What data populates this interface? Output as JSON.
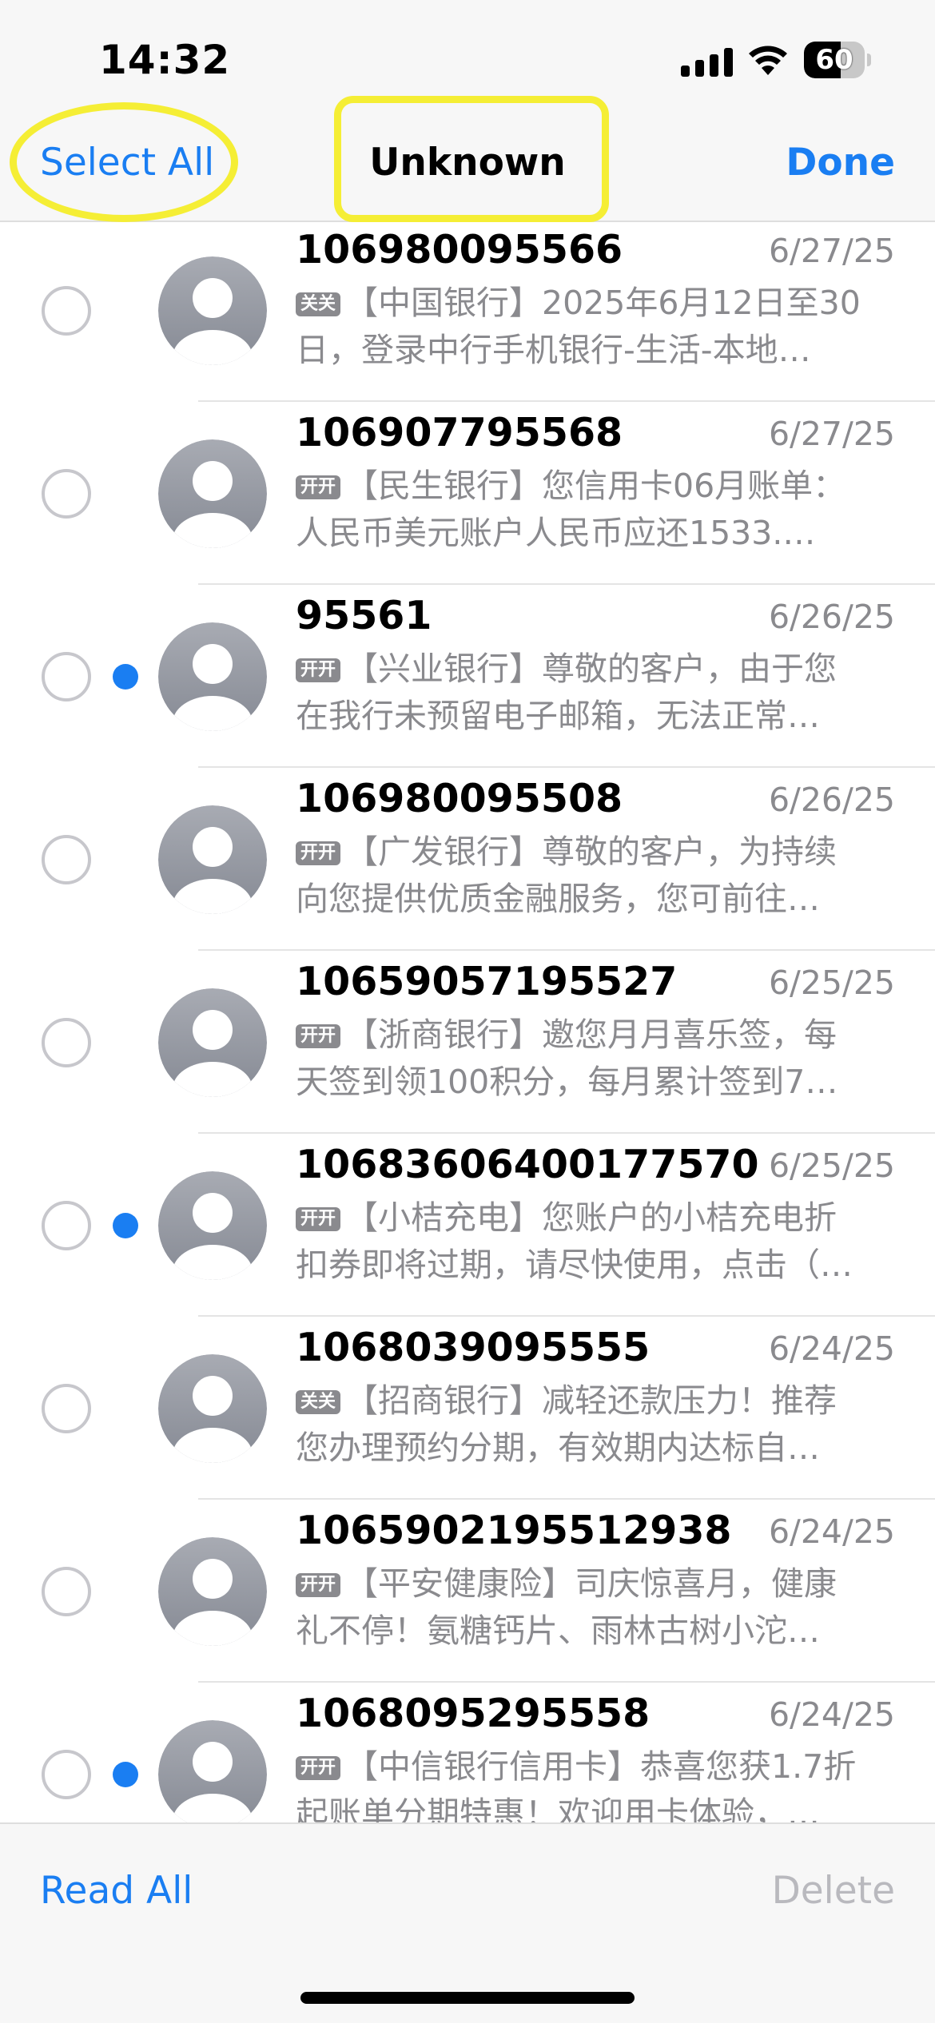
{
  "status_bar": {
    "time": "14:32",
    "battery_level": "60",
    "battery_fraction": 0.6,
    "icons": [
      "cellular-signal-icon",
      "wifi-icon",
      "battery-icon"
    ]
  },
  "nav": {
    "select_all": "Select All",
    "title": "Unknown",
    "done": "Done"
  },
  "colors": {
    "accent": "#1a7ef2",
    "secondary_text": "#8a8a8e",
    "highlight": "#f5ee35",
    "unread_dot": "#1a7ef2",
    "avatar_gradient": [
      "#a8abb3",
      "#868a94"
    ]
  },
  "messages": [
    {
      "sender": "106980095566",
      "date": "6/27/25",
      "unread": false,
      "badge": "关关",
      "line1": "【中国银行】2025年6月12日至30",
      "line2": "日，登录中行手机银行-生活-本地…"
    },
    {
      "sender": "106907795568",
      "date": "6/27/25",
      "unread": false,
      "badge": "开开",
      "line1": "【民生银行】您信用卡06月账单：",
      "line2": "人民币美元账户人民币应还1533.…"
    },
    {
      "sender": "95561",
      "date": "6/26/25",
      "unread": true,
      "badge": "开开",
      "line1": "【兴业银行】尊敬的客户，由于您",
      "line2": "在我行未预留电子邮箱，无法正常…"
    },
    {
      "sender": "106980095508",
      "date": "6/26/25",
      "unread": false,
      "badge": "开开",
      "line1": "【广发银行】尊敬的客户，为持续",
      "line2": "向您提供优质金融服务，您可前往…"
    },
    {
      "sender": "10659057195527",
      "date": "6/25/25",
      "unread": false,
      "badge": "开开",
      "line1": "【浙商银行】邀您月月喜乐签，每",
      "line2": "天签到领100积分，每月累计签到7…"
    },
    {
      "sender": "1068360640017757​0",
      "date": "6/25/25",
      "unread": true,
      "badge": "开开",
      "line1": "【小桔充电】您账户的小桔充电折",
      "line2": "扣券即将过期，请尽快使用，点击（…"
    },
    {
      "sender": "1068039095555",
      "date": "6/24/25",
      "unread": false,
      "badge": "关关",
      "line1": "【招商银行】减轻还款压力！推荐",
      "line2": "您办理预约分期，有效期内达标自…"
    },
    {
      "sender": "1065902195512938",
      "date": "6/24/25",
      "unread": false,
      "badge": "开开",
      "line1": "【平安健康险】司庆惊喜月，健康",
      "line2": "礼不停！氨糖钙片、雨林古树小沱…"
    },
    {
      "sender": "1068095295558",
      "date": "6/24/25",
      "unread": true,
      "badge": "开开",
      "line1": "【中信银行信用卡】恭喜您获1.7折",
      "line2": "起账单分期特惠！欢迎用卡体验，…"
    }
  ],
  "toolbar": {
    "read_all": "Read All",
    "delete": "Delete"
  }
}
